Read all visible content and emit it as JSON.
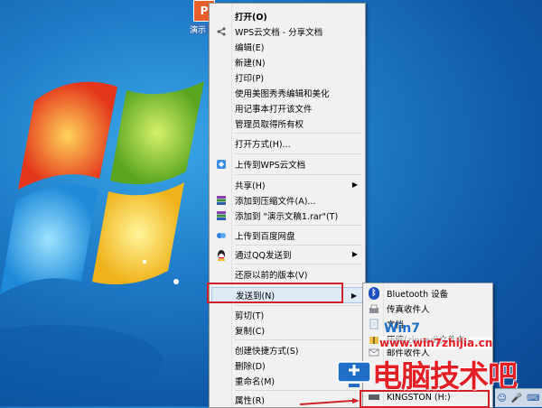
{
  "desktop": {
    "icon_label": "演示",
    "icon_glyph": "P"
  },
  "context_menu": {
    "items": [
      {
        "label": "打开(O)",
        "icon": "",
        "bold": true
      },
      {
        "label": "WPS云文档 - 分享文档",
        "icon": "share-icon"
      },
      {
        "label": "编辑(E)",
        "icon": ""
      },
      {
        "label": "新建(N)",
        "icon": ""
      },
      {
        "label": "打印(P)",
        "icon": ""
      },
      {
        "label": "使用美图秀秀编辑和美化",
        "icon": ""
      },
      {
        "label": "用记事本打开该文件",
        "icon": ""
      },
      {
        "label": "管理员取得所有权",
        "icon": ""
      },
      {
        "label": "打开方式(H)...",
        "icon": ""
      },
      {
        "label": "上传到WPS云文档",
        "icon": "wps-cloud-icon"
      },
      {
        "label": "共享(H)",
        "icon": "",
        "arrow": true
      },
      {
        "label": "添加到压缩文件(A)...",
        "icon": "winrar-icon"
      },
      {
        "label": "添加到 \"演示文稿1.rar\"(T)",
        "icon": "winrar-icon"
      },
      {
        "label": "上传到百度网盘",
        "icon": "baidu-netdisk-icon"
      },
      {
        "label": "通过QQ发送到",
        "icon": "qq-icon",
        "arrow": true
      },
      {
        "label": "还原以前的版本(V)",
        "icon": ""
      },
      {
        "label": "发送到(N)",
        "icon": "",
        "arrow": true
      },
      {
        "label": "剪切(T)",
        "icon": ""
      },
      {
        "label": "复制(C)",
        "icon": ""
      },
      {
        "label": "创建快捷方式(S)",
        "icon": ""
      },
      {
        "label": "删除(D)",
        "icon": ""
      },
      {
        "label": "重命名(M)",
        "icon": ""
      },
      {
        "label": "属性(R)",
        "icon": ""
      }
    ]
  },
  "send_to_menu": {
    "items": [
      {
        "label": "Bluetooth 设备",
        "icon": "bluetooth-icon"
      },
      {
        "label": "传真收件人",
        "icon": "fax-icon"
      },
      {
        "label": "文档",
        "icon": "documents-icon"
      },
      {
        "label": "压缩(zipped)文件夹",
        "icon": "zip-folder-icon"
      },
      {
        "label": "邮件收件人",
        "icon": "mail-icon"
      },
      {
        "label": "KINGSTON (H:)",
        "icon": "usb-drive-icon"
      }
    ]
  },
  "watermark": {
    "site": "www.win7zhijia.cn",
    "brand": "电脑技术吧"
  },
  "colors": {
    "highlight_border": "#d0202a",
    "menu_bg": "#f1f1f1"
  }
}
